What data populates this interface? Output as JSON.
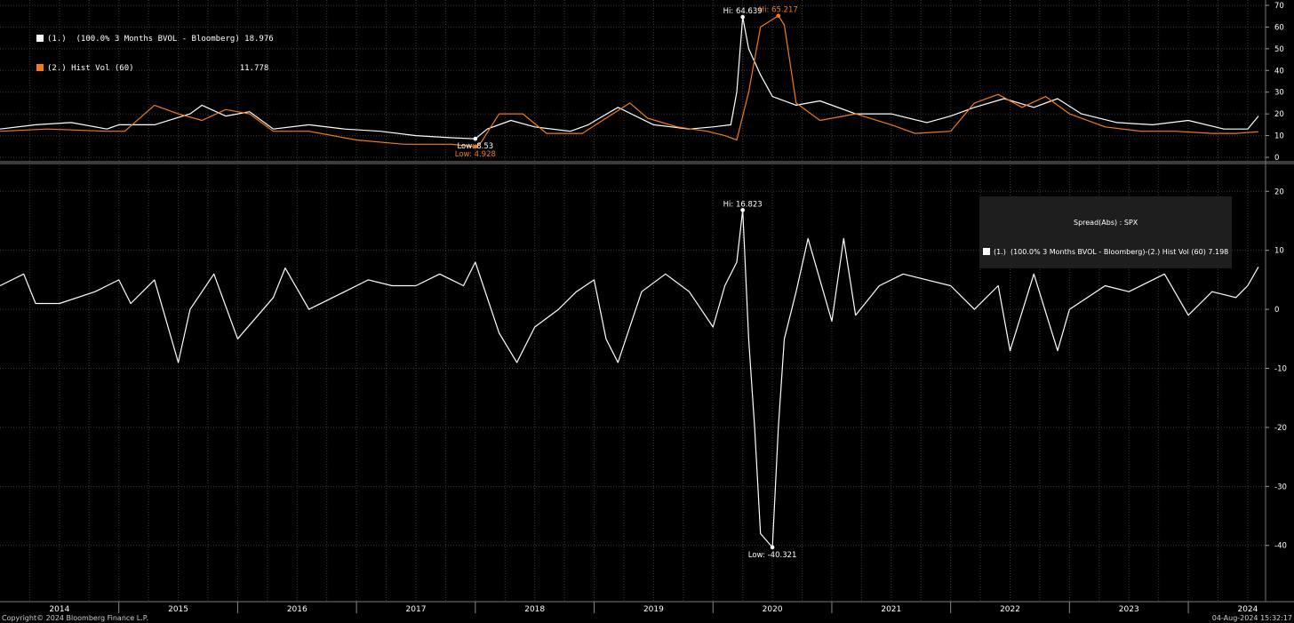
{
  "colors": {
    "background": "#000000",
    "grid": "#3a3a3a",
    "series1": "#ffffff",
    "series2": "#f07c1c",
    "axis_text": "#ffffff"
  },
  "legend_top": {
    "s1_label": "(1.)  (100.0% 3 Months BVOL - Bloomberg)",
    "s1_value": "18.976",
    "s2_label": "(2.) Hist Vol (60)",
    "s2_value": "11.778"
  },
  "legend_bottom": {
    "title": "Spread(Abs) : SPX",
    "label": "(1.)  (100.0% 3 Months BVOL - Bloomberg)-(2.) Hist Vol (60) 7.198"
  },
  "footer": {
    "copyright": "Copyright© 2024 Bloomberg Finance L.P.",
    "timestamp": "04-Aug-2024 15:32:17"
  },
  "chart_data": [
    {
      "type": "line",
      "panel": "top",
      "ylim": [
        0,
        70
      ],
      "yticks": [
        "0",
        "10",
        "20",
        "30",
        "40",
        "50",
        "60",
        "70"
      ],
      "series": [
        {
          "name": "(1.)  (100.0% 3 Months BVOL - Bloomberg)",
          "color": "#ffffff",
          "x": [
            2014.0,
            2014.3,
            2014.6,
            2014.9,
            2015.0,
            2015.3,
            2015.6,
            2015.7,
            2015.9,
            2016.1,
            2016.3,
            2016.6,
            2016.9,
            2017.2,
            2017.5,
            2017.8,
            2018.0,
            2018.1,
            2018.3,
            2018.5,
            2018.8,
            2018.95,
            2019.2,
            2019.5,
            2019.8,
            2020.0,
            2020.15,
            2020.2,
            2020.25,
            2020.3,
            2020.4,
            2020.5,
            2020.7,
            2020.9,
            2021.2,
            2021.5,
            2021.8,
            2022.0,
            2022.2,
            2022.45,
            2022.7,
            2022.9,
            2023.1,
            2023.4,
            2023.7,
            2024.0,
            2024.3,
            2024.5,
            2024.59
          ],
          "y": [
            13,
            15,
            16,
            13,
            15,
            15,
            20,
            24,
            19,
            21,
            13,
            15,
            13,
            12,
            10,
            9,
            8.53,
            13,
            17,
            14,
            12,
            15,
            23,
            15,
            13,
            14,
            15,
            30,
            64.639,
            50,
            38,
            28,
            24,
            26,
            20,
            20,
            16,
            19,
            23,
            27,
            23,
            27,
            20,
            16,
            15,
            17,
            13,
            13,
            18.976
          ],
          "annotations": [
            {
              "text": "Hi: 64.639",
              "x": 2020.25,
              "y": 64.639
            },
            {
              "text": "Low: 8.53",
              "x": 2018.0,
              "y": 8.53
            }
          ]
        },
        {
          "name": "(2.) Hist Vol (60)",
          "color": "#f07c1c",
          "x": [
            2014.0,
            2014.4,
            2014.9,
            2015.05,
            2015.3,
            2015.5,
            2015.7,
            2015.9,
            2016.1,
            2016.3,
            2016.6,
            2017.0,
            2017.4,
            2017.8,
            2018.0,
            2018.05,
            2018.2,
            2018.4,
            2018.6,
            2018.9,
            2019.1,
            2019.3,
            2019.45,
            2019.7,
            2019.95,
            2020.1,
            2020.2,
            2020.3,
            2020.4,
            2020.55,
            2020.6,
            2020.7,
            2020.9,
            2021.2,
            2021.5,
            2021.7,
            2022.0,
            2022.2,
            2022.4,
            2022.6,
            2022.8,
            2023.0,
            2023.3,
            2023.6,
            2023.9,
            2024.2,
            2024.4,
            2024.59
          ],
          "y": [
            12,
            13,
            12,
            12,
            24,
            20,
            17,
            22,
            20,
            12,
            12,
            8,
            6,
            6,
            4.928,
            7,
            20,
            20,
            11,
            11,
            18,
            25,
            18,
            14,
            12,
            10,
            8,
            30,
            60,
            65.217,
            61,
            25,
            17,
            20,
            15,
            11,
            12,
            25,
            29,
            23,
            28,
            20,
            14,
            12,
            12,
            11,
            11,
            11.778
          ],
          "annotations": [
            {
              "text": "Hi: 65.217",
              "x": 2020.55,
              "y": 65.217
            },
            {
              "text": "Low: 4.928",
              "x": 2018.0,
              "y": 4.928
            }
          ]
        }
      ]
    },
    {
      "type": "line",
      "panel": "bottom",
      "ylim": [
        -42,
        22
      ],
      "yticks": [
        "-40",
        "-30",
        "-20",
        "-10",
        "0",
        "10",
        "20"
      ],
      "series": [
        {
          "name": "(1.)  (100.0% 3 Months BVOL - Bloomberg)-(2.) Hist Vol (60)",
          "color": "#ffffff",
          "x": [
            2014.0,
            2014.2,
            2014.3,
            2014.5,
            2014.8,
            2015.0,
            2015.1,
            2015.3,
            2015.5,
            2015.6,
            2015.8,
            2016.0,
            2016.3,
            2016.4,
            2016.6,
            2016.9,
            2017.1,
            2017.3,
            2017.5,
            2017.7,
            2017.9,
            2018.0,
            2018.2,
            2018.35,
            2018.5,
            2018.7,
            2018.85,
            2019.0,
            2019.1,
            2019.2,
            2019.4,
            2019.6,
            2019.8,
            2019.9,
            2020.0,
            2020.1,
            2020.2,
            2020.25,
            2020.3,
            2020.35,
            2020.4,
            2020.5,
            2020.55,
            2020.6,
            2020.7,
            2020.8,
            2020.9,
            2021.0,
            2021.1,
            2021.2,
            2021.4,
            2021.6,
            2021.8,
            2022.0,
            2022.2,
            2022.4,
            2022.5,
            2022.7,
            2022.9,
            2023.0,
            2023.3,
            2023.5,
            2023.8,
            2024.0,
            2024.2,
            2024.4,
            2024.5,
            2024.59
          ],
          "y": [
            4,
            6,
            1,
            1,
            3,
            5,
            1,
            5,
            -9,
            0,
            6,
            -5,
            2,
            7,
            0,
            3,
            5,
            4,
            4,
            6,
            4,
            8,
            -4,
            -9,
            -3,
            0,
            3,
            5,
            -5,
            -9,
            3,
            6,
            3,
            0,
            -3,
            4,
            8,
            16.823,
            -5,
            -20,
            -38,
            -40.321,
            -20,
            -5,
            3,
            12,
            5,
            -2,
            12,
            -1,
            4,
            6,
            5,
            4,
            0,
            4,
            -7,
            6,
            -7,
            0,
            4,
            3,
            6,
            -1,
            3,
            2,
            4,
            7.198
          ],
          "annotations": [
            {
              "text": "Hi: 16.823",
              "x": 2020.25,
              "y": 16.823
            },
            {
              "text": "Low: -40.321",
              "x": 2020.5,
              "y": -40.321
            }
          ]
        }
      ]
    }
  ],
  "x_axis": {
    "xlim": [
      2014.0,
      2024.65
    ],
    "labels": [
      "2014",
      "2015",
      "2016",
      "2017",
      "2018",
      "2019",
      "2020",
      "2021",
      "2022",
      "2023",
      "2024"
    ]
  }
}
